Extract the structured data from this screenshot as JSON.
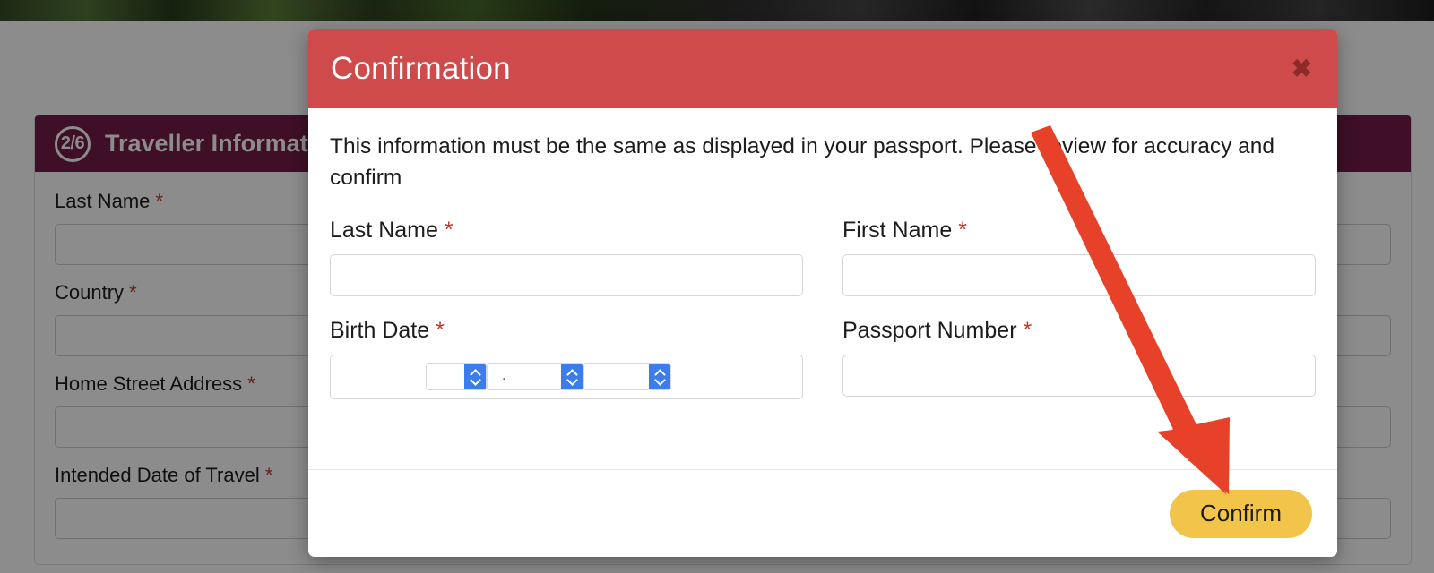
{
  "background": {
    "card": {
      "step_badge": "2/6",
      "title": "Traveller Information",
      "fields": [
        {
          "label": "Last Name",
          "required_marker": "*"
        },
        {
          "label": "Country",
          "required_marker": "*"
        },
        {
          "label": "Home Street Address",
          "required_marker": "*"
        },
        {
          "label": "Intended Date of Travel",
          "required_marker": "*"
        }
      ]
    }
  },
  "modal": {
    "title": "Confirmation",
    "close_icon": "close-icon",
    "close_glyph": "✖",
    "message": "This information must be the same as displayed in your passport. Please review for accuracy and confirm",
    "fields": [
      {
        "label": "Last Name",
        "required_marker": "*",
        "value": "",
        "type": "text"
      },
      {
        "label": "First Name",
        "required_marker": "*",
        "value": "",
        "type": "text"
      },
      {
        "label": "Birth Date",
        "required_marker": "*",
        "value": "",
        "type": "date"
      },
      {
        "label": "Passport Number",
        "required_marker": "*",
        "value": "",
        "type": "text"
      }
    ],
    "date_parts": {
      "day": "",
      "month": "",
      "year": "",
      "separator": "."
    },
    "confirm_label": "Confirm"
  },
  "annotation": {
    "arrow": "red-arrow-pointing-to-confirm",
    "color": "#E8412A"
  },
  "colors": {
    "modal_header": "#CF4B4B",
    "card_header": "#721C45",
    "required_asterisk": "#C0392B",
    "confirm_button": "#F3C44A",
    "spinner_blue": "#3B7DEC",
    "close_icon": "#8E2A2A",
    "arrow": "#E8412A"
  }
}
